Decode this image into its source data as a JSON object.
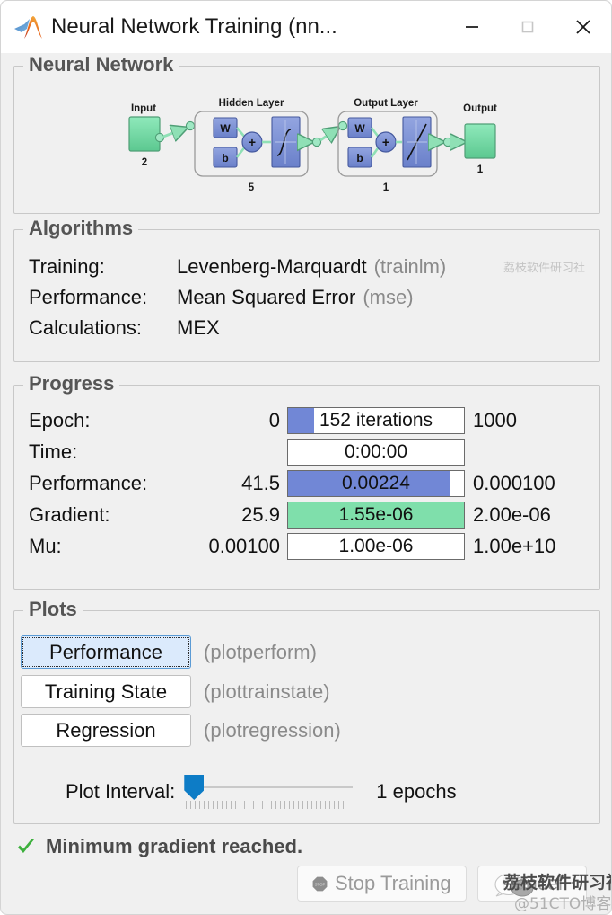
{
  "window": {
    "title": "Neural Network Training (nn...",
    "logo_icon": "matlab-membrane-icon",
    "controls": {
      "minimize": "minimize-icon",
      "maximize": "maximize-icon",
      "close": "close-icon"
    }
  },
  "network_section": {
    "title": "Neural Network",
    "input": {
      "label": "Input",
      "size": "2"
    },
    "hidden_layer": {
      "label": "Hidden Layer",
      "size": "5",
      "w": "W",
      "b": "b",
      "sum": "+",
      "transfer": "sigmoid"
    },
    "output_layer": {
      "label": "Output Layer",
      "size": "1",
      "w": "W",
      "b": "b",
      "sum": "+",
      "transfer": "linear"
    },
    "output": {
      "label": "Output",
      "size": "1"
    }
  },
  "algorithms_section": {
    "title": "Algorithms",
    "rows": [
      {
        "label": "Training:",
        "value": "Levenberg-Marquardt",
        "func": "(trainlm)"
      },
      {
        "label": "Performance:",
        "value": "Mean Squared Error",
        "func": "(mse)"
      },
      {
        "label": "Calculations:",
        "value": "MEX",
        "func": ""
      }
    ]
  },
  "progress_section": {
    "title": "Progress",
    "rows": [
      {
        "label": "Epoch:",
        "min": "0",
        "value": "152 iterations",
        "max": "1000",
        "fill_pct": 15,
        "state": "running"
      },
      {
        "label": "Time:",
        "min": "",
        "value": "0:00:00",
        "max": "",
        "fill_pct": 0,
        "state": "none"
      },
      {
        "label": "Performance:",
        "min": "41.5",
        "value": "0.00224",
        "max": "0.000100",
        "fill_pct": 92,
        "state": "running"
      },
      {
        "label": "Gradient:",
        "min": "25.9",
        "value": "1.55e-06",
        "max": "2.00e-06",
        "fill_pct": 100,
        "state": "done"
      },
      {
        "label": "Mu:",
        "min": "0.00100",
        "value": "1.00e-06",
        "max": "1.00e+10",
        "fill_pct": 0,
        "state": "none"
      }
    ]
  },
  "plots_section": {
    "title": "Plots",
    "buttons": [
      {
        "label": "Performance",
        "func": "(plotperform)",
        "selected": true
      },
      {
        "label": "Training State",
        "func": "(plottrainstate)",
        "selected": false
      },
      {
        "label": "Regression",
        "func": "(plotregression)",
        "selected": false
      }
    ],
    "interval": {
      "label": "Plot Interval:",
      "value": "1 epochs",
      "slider_pct": 0
    }
  },
  "status": {
    "icon": "check-icon",
    "message": "Minimum gradient reached."
  },
  "footer": {
    "stop_button": {
      "label": "Stop Training",
      "icon": "stop-sign-icon",
      "disabled": true
    },
    "cancel_button": {
      "label": "Cancel",
      "disabled": true
    }
  },
  "watermarks": {
    "chinese": "荔枝软件研习社",
    "blog": "@51CTO博客"
  },
  "colors": {
    "bar_blue": "#7187d6",
    "bar_green": "#7fdfab",
    "node_green": "#7fdfab",
    "block_blue": "#7b8ed4",
    "accent_slider": "#0d7cc6",
    "group_title": "#555555",
    "muted_text": "#8a8a8a"
  }
}
